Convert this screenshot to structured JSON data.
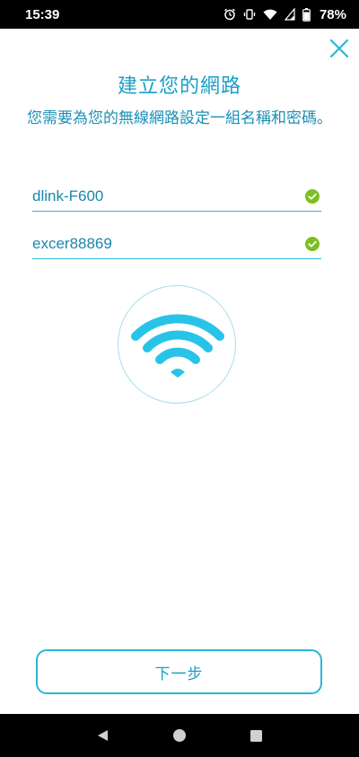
{
  "status_bar": {
    "time": "15:39",
    "battery_percent": "78%",
    "icons": [
      "alarm-icon",
      "vibrate-icon",
      "wifi-icon",
      "signal-icon",
      "battery-icon"
    ]
  },
  "header": {
    "close_icon": "close-icon",
    "title": "建立您的網路",
    "subtitle": "您需要為您的無線網路設定一組名稱和密碼。"
  },
  "form": {
    "network_name": "dlink-F600",
    "password": "excer88869",
    "valid_icon": "check-circle-icon"
  },
  "illustration": {
    "icon": "wifi-icon"
  },
  "actions": {
    "next_label": "下一步"
  },
  "nav_bar": {
    "items": [
      "back-icon",
      "home-icon",
      "recents-icon"
    ]
  },
  "colors": {
    "accent": "#29b6d8",
    "title": "#1a9fc4",
    "check": "#7cbf1e",
    "bar": "#000000"
  }
}
